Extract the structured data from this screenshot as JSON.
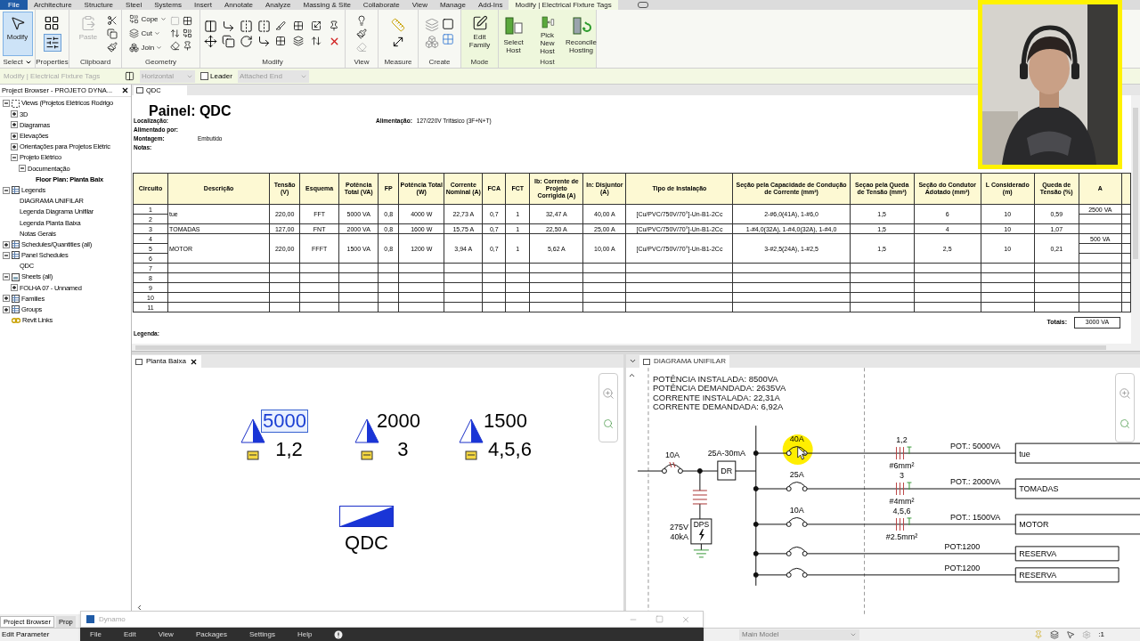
{
  "menu_tabs": [
    {
      "label": "File",
      "kind": "file",
      "selected": false
    },
    {
      "label": "Architecture",
      "kind": "tab",
      "selected": false
    },
    {
      "label": "Structure",
      "kind": "tab",
      "selected": false
    },
    {
      "label": "Steel",
      "kind": "tab",
      "selected": false
    },
    {
      "label": "Systems",
      "kind": "tab",
      "selected": false
    },
    {
      "label": "Insert",
      "kind": "tab",
      "selected": false
    },
    {
      "label": "Annotate",
      "kind": "tab",
      "selected": false
    },
    {
      "label": "Analyze",
      "kind": "tab",
      "selected": false
    },
    {
      "label": "Massing & Site",
      "kind": "tab",
      "selected": false
    },
    {
      "label": "Collaborate",
      "kind": "tab",
      "selected": false
    },
    {
      "label": "View",
      "kind": "tab",
      "selected": false
    },
    {
      "label": "Manage",
      "kind": "tab",
      "selected": false
    },
    {
      "label": "Add-Ins",
      "kind": "tab",
      "selected": false
    },
    {
      "label": "Modify | Electrical Fixture Tags",
      "kind": "tab",
      "selected": true
    }
  ],
  "ribbon": {
    "panels": [
      {
        "label": "Select",
        "dropdown": true,
        "buttons": [
          {
            "label": "Modify",
            "kind": "large",
            "selected": true
          }
        ]
      },
      {
        "label": "Properties"
      },
      {
        "label": "Clipboard",
        "buttons": [
          {
            "label": "Paste",
            "kind": "large",
            "disabled": true
          }
        ]
      },
      {
        "label": "Geometry",
        "buttons": [
          {
            "label": "Cope",
            "kind": "small"
          },
          {
            "label": "Cut",
            "kind": "small"
          },
          {
            "label": "Join",
            "kind": "small"
          }
        ]
      },
      {
        "label": "Modify"
      },
      {
        "label": "View"
      },
      {
        "label": "Measure"
      },
      {
        "label": "Create"
      },
      {
        "label": "Mode",
        "contextual": true,
        "buttons": [
          {
            "label": "Edit Family",
            "kind": "large"
          }
        ]
      },
      {
        "label": "Host",
        "contextual": true,
        "buttons": [
          {
            "label": "Select Host",
            "kind": "large"
          },
          {
            "label": "Pick New Host",
            "kind": "large"
          },
          {
            "label": "Reconcile Hosting",
            "kind": "large"
          }
        ]
      }
    ]
  },
  "options_bar": {
    "context": "Modify | Electrical Fixture Tags",
    "orientation": "Horizontal",
    "leader": {
      "label": "Leader",
      "checked": false
    },
    "leader_end": "Attached End"
  },
  "project_browser": {
    "title": "Project Browser - PROJETO DYNA...",
    "tree": [
      {
        "label": "Views (Projetos Elétricos Rodrigo",
        "kind": "views",
        "expanded": true,
        "children": [
          {
            "label": "3D",
            "expanded": false
          },
          {
            "label": "Diagramas",
            "expanded": false
          },
          {
            "label": "Elevações",
            "expanded": false
          },
          {
            "label": "Orientações para Projetos Elétric",
            "expanded": false
          },
          {
            "label": "Projeto Elétrico",
            "expanded": true,
            "children": [
              {
                "label": "Documentação",
                "expanded": true,
                "children": [
                  {
                    "label": "Floor Plan: Planta Baix",
                    "active": true
                  }
                ]
              }
            ]
          }
        ]
      },
      {
        "label": "Legends",
        "kind": "table",
        "expanded": true,
        "children": [
          {
            "label": "DIAGRAMA UNIFILAR",
            "active": false
          },
          {
            "label": "Legenda Diagrama Unifilar",
            "active": false
          },
          {
            "label": "Legenda Planta Baixa",
            "active": false
          },
          {
            "label": "Notas Gerais",
            "active": false
          }
        ]
      },
      {
        "label": "Schedules/Quantities (all)",
        "kind": "table",
        "expanded": false
      },
      {
        "label": "Panel Schedules",
        "kind": "table",
        "expanded": true,
        "children": [
          {
            "label": "QDC",
            "active": false
          }
        ]
      },
      {
        "label": "Sheets (all)",
        "kind": "sheet",
        "expanded": true,
        "children": [
          {
            "label": "FOLHA 07 - Unnamed",
            "expanded": false
          }
        ]
      },
      {
        "label": "Families",
        "kind": "table",
        "expanded": false
      },
      {
        "label": "Groups",
        "kind": "table",
        "expanded": false
      },
      {
        "label": "Revit Links",
        "kind": "link"
      }
    ],
    "tabs": [
      {
        "label": "Project Browser",
        "selected": true
      },
      {
        "label": "Prop",
        "selected": false
      }
    ]
  },
  "schedule_view": {
    "tab": "QDC",
    "title": "Painel: QDC",
    "fields": [
      {
        "label": "Localização:"
      },
      {
        "label": "Alimentado por:"
      },
      {
        "label": "Montagem:",
        "value": "Embutido"
      },
      {
        "label": "Notas:"
      }
    ],
    "supply": {
      "label": "Alimentação:",
      "value": "127/220V Trifásico (3F+N+T)"
    },
    "columns": [
      "Circuito",
      "Descrição",
      "Tensão (V)",
      "Esquema",
      "Potência Total (VA)",
      "FP",
      "Potência Total (W)",
      "Corrente Nominal (A)",
      "FCA",
      "FCT",
      "Ib: Corrente de Projeto Corrigida (A)",
      "In: Disjuntor (A)",
      "Tipo de Instalação",
      "Seção pela Capacidade de Condução de Corrente (mm²)",
      "Seçao pela Queda de Tensão (mm²)",
      "Seção do Condutor Adotado (mm²)",
      "L Considerado (m)",
      "Queda de Tensão (%)",
      "A"
    ],
    "rows": [
      {
        "circuits": [
          "1",
          "2"
        ],
        "description": "tue",
        "values": [
          "220,00",
          "FFT",
          "5000 VA",
          "0,8",
          "4000 W",
          "22,73 A",
          "0,7",
          "1",
          "32,47 A",
          "40,00 A",
          "[Cu/PVC/750V/70°]-Un-B1-2Cc",
          "2-#6,0(41A), 1-#6,0",
          "1,5",
          "6",
          "10",
          "0,59"
        ],
        "phase_a": "2500 VA"
      },
      {
        "circuits": [
          "3"
        ],
        "description": "TOMADAS",
        "values": [
          "127,00",
          "FNT",
          "2000 VA",
          "0,8",
          "1600 W",
          "15,75 A",
          "0,7",
          "1",
          "22,50 A",
          "25,00 A",
          "[Cu/PVC/750V/70°]-Un-B1-2Cc",
          "1-#4,0(32A), 1-#4,0(32A), 1-#4,0",
          "1,5",
          "4",
          "10",
          "1,07"
        ]
      },
      {
        "circuits": [
          "4",
          "5",
          "6"
        ],
        "description": "MOTOR",
        "values": [
          "220,00",
          "FFFT",
          "1500 VA",
          "0,8",
          "1200 W",
          "3,94 A",
          "0,7",
          "1",
          "5,62 A",
          "10,00 A",
          "[Cu/PVC/750V/70°]-Un-B1-2Cc",
          "3-#2,5(24A), 1-#2,5",
          "1,5",
          "2,5",
          "10",
          "0,21"
        ],
        "phase_a": "500 VA"
      },
      {
        "circuits": [
          "7"
        ]
      },
      {
        "circuits": [
          "8"
        ]
      },
      {
        "circuits": [
          "9"
        ]
      },
      {
        "circuits": [
          "10"
        ]
      },
      {
        "circuits": [
          "11"
        ]
      }
    ],
    "totals_label": "Totais:",
    "totals_value": "3000 VA",
    "legend_label": "Legenda:"
  },
  "plan_view": {
    "tab": "Planta Baixa",
    "tags": [
      {
        "power": "5000",
        "circuits": "1,2",
        "selected": true
      },
      {
        "power": "2000",
        "circuits": "3",
        "selected": false
      },
      {
        "power": "1500",
        "circuits": "4,5,6",
        "selected": false
      }
    ],
    "panel_label": "QDC"
  },
  "diagram_view": {
    "tab": "DIAGRAMA UNIFILAR",
    "summary": [
      "POTÊNCIA INSTALADA: 8500VA",
      "POTÊNCIA DEMANDADA: 2635VA",
      "CORRENTE INSTALADA: 22,31A",
      "CORRENTE DEMANDADA: 6,92A"
    ],
    "main_breaker": "10A",
    "dr_rating": "25A-30mA",
    "dr_label": "DR",
    "dps_voltage": "275V",
    "dps_current": "40kA",
    "dps_label": "DPS",
    "circuits": [
      {
        "kind": "circuit",
        "breaker": "40A",
        "circuits": "1,2",
        "wire": "#6mm²",
        "power": "POT.: 5000VA",
        "load": "tue"
      },
      {
        "kind": "circuit",
        "breaker": "25A",
        "circuits": "3",
        "wire": "#4mm²",
        "power": "POT.: 2000VA",
        "load": "TOMADAS"
      },
      {
        "kind": "circuit",
        "breaker": "10A",
        "circuits": "4,5,6",
        "wire": "#2.5mm²",
        "power": "POT.: 1500VA",
        "load": "MOTOR"
      },
      {
        "kind": "reserve",
        "power": "POT:1200",
        "load": "RESERVA"
      },
      {
        "kind": "reserve",
        "power": "POT:1200",
        "load": "RESERVA"
      }
    ]
  },
  "dynamo": {
    "title": "Dynamo",
    "menu": [
      "File",
      "Edit",
      "View",
      "Packages",
      "Settings",
      "Help"
    ]
  },
  "status_bar": {
    "text": "Edit Parameter",
    "model": "Main Model",
    "selection_count": ":1"
  }
}
